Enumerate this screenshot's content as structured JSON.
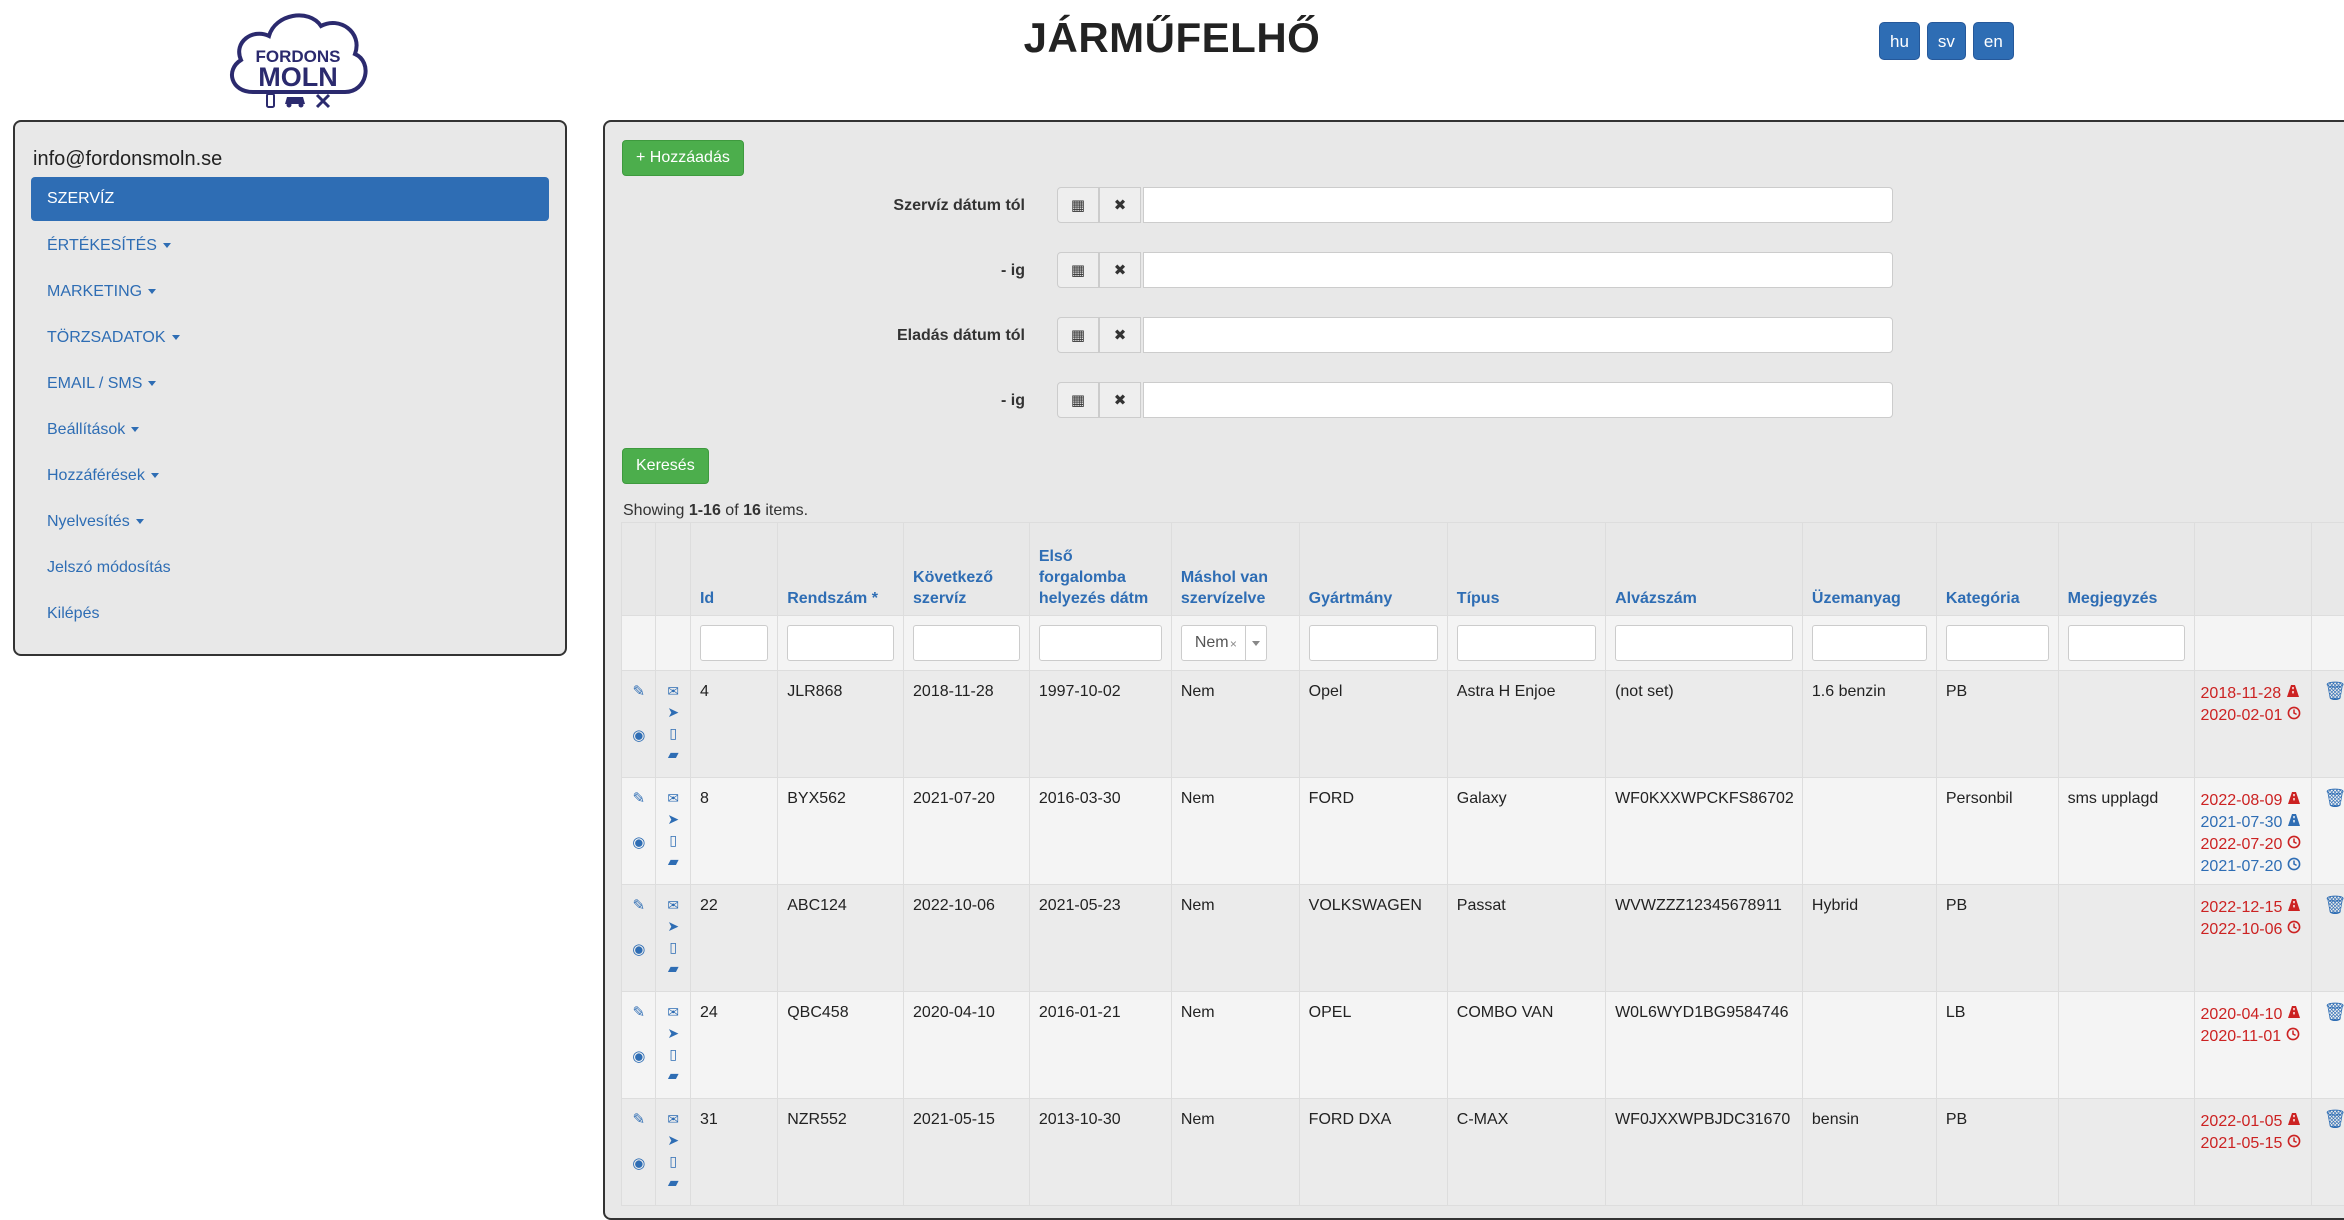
{
  "header": {
    "logo_top": "FORDONS",
    "logo_bottom": "MOLN",
    "title": "JÁRMŰFELHŐ",
    "languages": [
      "hu",
      "sv",
      "en"
    ]
  },
  "sidebar": {
    "email": "info@fordonsmoln.se",
    "items": [
      {
        "label": "SZERVÍZ",
        "active": true,
        "dropdown": false
      },
      {
        "label": "ÉRTÉKESÍTÉS",
        "active": false,
        "dropdown": true
      },
      {
        "label": "MARKETING",
        "active": false,
        "dropdown": true
      },
      {
        "label": "TÖRZSADATOK",
        "active": false,
        "dropdown": true
      },
      {
        "label": "EMAIL / SMS",
        "active": false,
        "dropdown": true
      },
      {
        "label": "Beállítások",
        "active": false,
        "dropdown": true
      },
      {
        "label": "Hozzáférések",
        "active": false,
        "dropdown": true
      },
      {
        "label": "Nyelvesítés",
        "active": false,
        "dropdown": true
      },
      {
        "label": "Jelszó módosítás",
        "active": false,
        "dropdown": false
      },
      {
        "label": "Kilépés",
        "active": false,
        "dropdown": false
      }
    ]
  },
  "main": {
    "add_label": "+ Hozzáadás",
    "search_label": "Keresés",
    "filters": [
      {
        "label": "Szervíz dátum tól",
        "value": ""
      },
      {
        "label": "- ig",
        "value": ""
      },
      {
        "label": "Eladás dátum tól",
        "value": ""
      },
      {
        "label": "- ig",
        "value": ""
      }
    ],
    "summary": {
      "prefix": "Showing ",
      "range": "1-16",
      "mid": " of ",
      "total": "16",
      "suffix": " items."
    },
    "columns": [
      "Id",
      "Rendszám *",
      "Következő szervíz",
      "Első forgalomba helyezés dátm",
      "Máshol van szervízelve",
      "Gyártmány",
      "Típus",
      "Alvázszám",
      "Üzemanyag",
      "Kategória",
      "Megjegyzés"
    ],
    "select_filter_value": "Nem",
    "rows": [
      {
        "id": "4",
        "plate": "JLR868",
        "next_service": "2018-11-28",
        "first_reg": "1997-10-02",
        "elsewhere": "Nem",
        "make": "Opel",
        "type": "Astra H Enjoe",
        "vin": "(not set)",
        "fuel": "1.6 benzin",
        "category": "PB",
        "note": "",
        "dates": [
          {
            "date": "2018-11-28",
            "color": "red",
            "icon": "road-icon"
          },
          {
            "date": "2020-02-01",
            "color": "red",
            "icon": "clock-icon"
          }
        ]
      },
      {
        "id": "8",
        "plate": "BYX562",
        "next_service": "2021-07-20",
        "first_reg": "2016-03-30",
        "elsewhere": "Nem",
        "make": "FORD",
        "type": "Galaxy",
        "vin": "WF0KXXWPCKFS86702",
        "fuel": "",
        "category": "Personbil",
        "note": "sms upplagd",
        "dates": [
          {
            "date": "2022-08-09",
            "color": "red",
            "icon": "road-icon"
          },
          {
            "date": "2021-07-30",
            "color": "blue",
            "icon": "road-icon"
          },
          {
            "date": "2022-07-20",
            "color": "red",
            "icon": "clock-icon"
          },
          {
            "date": "2021-07-20",
            "color": "blue",
            "icon": "clock-icon"
          }
        ]
      },
      {
        "id": "22",
        "plate": "ABC124",
        "next_service": "2022-10-06",
        "first_reg": "2021-05-23",
        "elsewhere": "Nem",
        "make": "VOLKSWAGEN",
        "type": "Passat",
        "vin": "WVWZZZ12345678911",
        "fuel": "Hybrid",
        "category": "PB",
        "note": "",
        "dates": [
          {
            "date": "2022-12-15",
            "color": "red",
            "icon": "road-icon"
          },
          {
            "date": "2022-10-06",
            "color": "red",
            "icon": "clock-icon"
          }
        ]
      },
      {
        "id": "24",
        "plate": "QBC458",
        "next_service": "2020-04-10",
        "first_reg": "2016-01-21",
        "elsewhere": "Nem",
        "make": "OPEL",
        "type": "COMBO VAN",
        "vin": "W0L6WYD1BG9584746",
        "fuel": "",
        "category": "LB",
        "note": "",
        "dates": [
          {
            "date": "2020-04-10",
            "color": "red",
            "icon": "road-icon"
          },
          {
            "date": "2020-11-01",
            "color": "red",
            "icon": "clock-icon"
          }
        ]
      },
      {
        "id": "31",
        "plate": "NZR552",
        "next_service": "2021-05-15",
        "first_reg": "2013-10-30",
        "elsewhere": "Nem",
        "make": "FORD DXA",
        "type": "C-MAX",
        "vin": "WF0JXXWPBJDC31670",
        "fuel": "bensin",
        "category": "PB",
        "note": "",
        "dates": [
          {
            "date": "2022-01-05",
            "color": "red",
            "icon": "road-icon"
          },
          {
            "date": "2021-05-15",
            "color": "red",
            "icon": "clock-icon"
          }
        ]
      }
    ]
  },
  "colors": {
    "primary": "#2e6db4",
    "success": "#4cae4c",
    "danger": "#cc2222",
    "panel": "#e8e8e8"
  }
}
